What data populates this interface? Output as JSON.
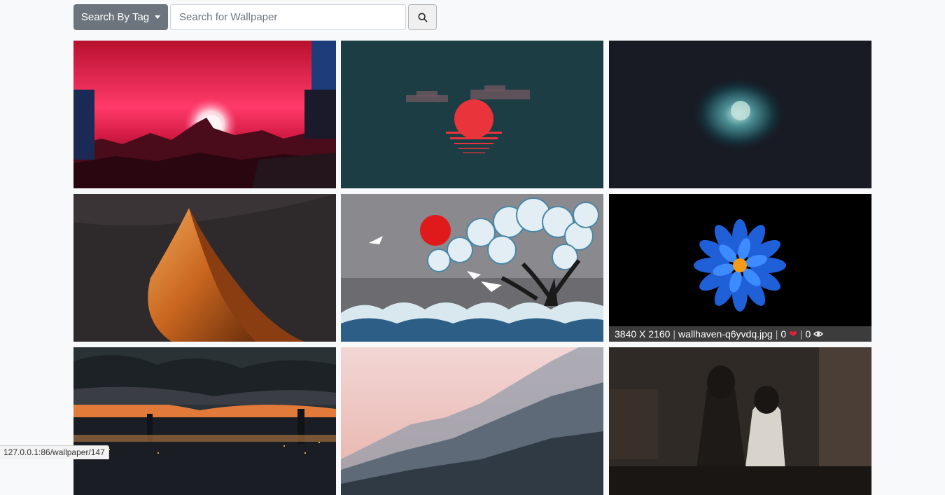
{
  "toolbar": {
    "tag_dropdown_label": "Search By Tag",
    "search_placeholder": "Search for Wallpaper",
    "search_value": ""
  },
  "wallpapers": [
    {
      "scene": "neon-red-city-sunset"
    },
    {
      "scene": "minimal-red-sun-teal-sea"
    },
    {
      "scene": "dark-teal-vortex"
    },
    {
      "scene": "desert-dune-orange"
    },
    {
      "scene": "japanese-waves-tree-cranes"
    },
    {
      "scene": "blue-flower-black",
      "resolution": "3840 X 2160",
      "filename": "wallhaven-q6yvdq.jpg",
      "likes": "0",
      "views": "0"
    },
    {
      "scene": "city-skyline-dusk-clouds"
    },
    {
      "scene": "misty-pink-mountains"
    },
    {
      "scene": "cyberpunk-girls-street"
    }
  ],
  "status": {
    "url": "127.0.0.1:86/wallpaper/147"
  },
  "colors": {
    "secondary": "#6c757d",
    "heart": "#e0203c",
    "page_bg": "#f8f9fa"
  }
}
